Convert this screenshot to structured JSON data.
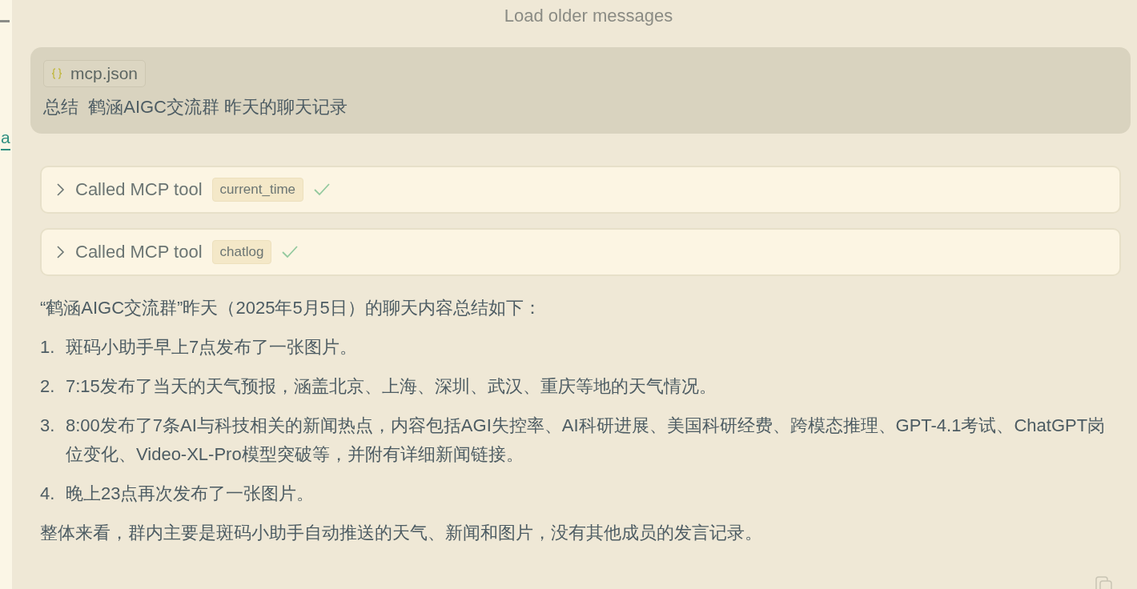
{
  "sidebar": {
    "link_text": "a"
  },
  "load_older": "Load older messages",
  "user_message": {
    "attachment": "mcp.json",
    "text": "总结  鹤涵AIGC交流群 昨天的聊天记录"
  },
  "tool_calls": [
    {
      "label": "Called MCP tool",
      "tool": "current_time",
      "expanded": false,
      "done": true
    },
    {
      "label": "Called MCP tool",
      "tool": "chatlog",
      "expanded": false,
      "done": true
    }
  ],
  "response": {
    "intro": "“鹤涵AIGC交流群”昨天（2025年5月5日）的聊天内容总结如下：",
    "items": [
      {
        "number": "1.",
        "text": "斑码小助手早上7点发布了一张图片。"
      },
      {
        "number": "2.",
        "text": "7:15发布了当天的天气预报，涵盖北京、上海、深圳、武汉、重庆等地的天气情况。"
      },
      {
        "number": "3.",
        "text": "8:00发布了7条AI与科技相关的新闻热点，内容包括AGI失控率、AI科研进展、美国科研经费、跨模态推理、GPT-4.1考试、ChatGPT岗位变化、Video-XL-Pro模型突破等，并附有详细新闻链接。"
      },
      {
        "number": "4.",
        "text": "晚上23点再次发布了一张图片。"
      }
    ],
    "conclusion": "整体来看，群内主要是斑码小助手自动推送的天气、新闻和图片，没有其他成员的发言记录。"
  }
}
